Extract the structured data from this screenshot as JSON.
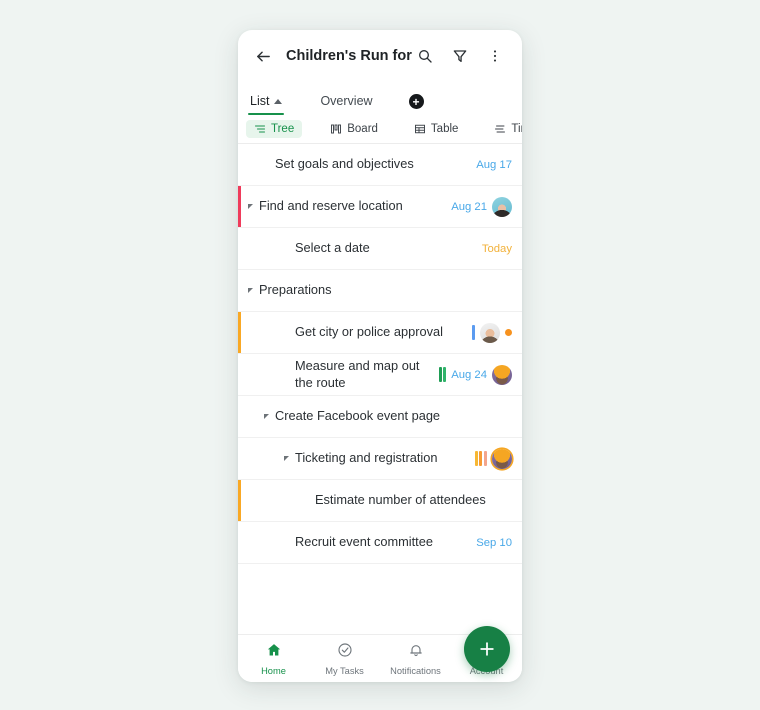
{
  "app": {
    "title": "Children's Run for ...",
    "back_icon": "back-arrow-icon",
    "search_icon": "search-icon",
    "filter_icon": "filter-icon",
    "more_icon": "more-vertical-icon"
  },
  "view_tabs": {
    "items": [
      {
        "label": "List",
        "active": true,
        "has_caret": true
      },
      {
        "label": "Overview",
        "active": false,
        "has_caret": false
      }
    ],
    "add_label": "+",
    "add_icon": "add-view-icon"
  },
  "mode_tabs": {
    "items": [
      {
        "label": "Tree",
        "icon": "tree-icon",
        "active": true
      },
      {
        "label": "Board",
        "icon": "board-icon",
        "active": false
      },
      {
        "label": "Table",
        "icon": "table-icon",
        "active": false
      },
      {
        "label": "Timeli",
        "icon": "timeline-icon",
        "active": false
      }
    ]
  },
  "tasks": [
    {
      "title": "Set goals and objectives",
      "indent": 1,
      "expandable": false,
      "strip": null,
      "date": "Aug 17",
      "date_style": "blue",
      "avatar": null,
      "dot": false,
      "bars": []
    },
    {
      "title": "Find and reserve location",
      "indent": 0,
      "expandable": true,
      "strip": "#ef3b5b",
      "date": "Aug 21",
      "date_style": "blue",
      "avatar": "woman-dark-hair-avatar",
      "dot": false,
      "bars": []
    },
    {
      "title": "Select a date",
      "indent": 2,
      "expandable": false,
      "strip": null,
      "date": "Today",
      "date_style": "amber",
      "avatar": null,
      "dot": false,
      "bars": []
    },
    {
      "title": "Preparations",
      "indent": 0,
      "expandable": true,
      "strip": null,
      "date": null,
      "date_style": null,
      "avatar": null,
      "dot": false,
      "bars": []
    },
    {
      "title": "Get city or police approval",
      "indent": 2,
      "expandable": false,
      "strip": "#f9a825",
      "date": null,
      "date_style": null,
      "avatar": "man-glasses-avatar",
      "dot": true,
      "bars": [
        "#5b9bf0"
      ]
    },
    {
      "title": "Measure and map out the route",
      "indent": 2,
      "expandable": false,
      "strip": null,
      "date": "Aug 24",
      "date_style": "blue",
      "avatar": "man-cap-avatar",
      "dot": false,
      "bars": [
        "#1f9d55",
        "#2fb36a"
      ]
    },
    {
      "title": "Create Facebook event page",
      "indent": 1,
      "expandable": true,
      "strip": null,
      "date": null,
      "date_style": null,
      "avatar": null,
      "dot": false,
      "bars": []
    },
    {
      "title": "Ticketing and registration",
      "indent": 2,
      "expandable": true,
      "strip": null,
      "date": null,
      "date_style": null,
      "avatar": "man-cap-avatar-ring",
      "dot": false,
      "bars": [
        "#f7b733",
        "#f79a33",
        "#f3a58c"
      ]
    },
    {
      "title": "Estimate number of attendees",
      "indent": 3,
      "expandable": false,
      "strip": "#f9a825",
      "date": null,
      "date_style": null,
      "avatar": null,
      "dot": false,
      "bars": []
    },
    {
      "title": "Recruit event committee",
      "indent": 2,
      "expandable": false,
      "strip": null,
      "date": "Sep 10",
      "date_style": "blue",
      "avatar": null,
      "dot": false,
      "bars": []
    }
  ],
  "fab": {
    "label": "+",
    "icon": "add-task-icon",
    "color": "#178045"
  },
  "bottom_nav": {
    "items": [
      {
        "label": "Home",
        "icon": "home-icon",
        "active": true
      },
      {
        "label": "My Tasks",
        "icon": "check-circle-icon",
        "active": false
      },
      {
        "label": "Notifications",
        "icon": "bell-icon",
        "active": false
      },
      {
        "label": "Account",
        "icon": "person-icon",
        "active": false
      }
    ]
  }
}
